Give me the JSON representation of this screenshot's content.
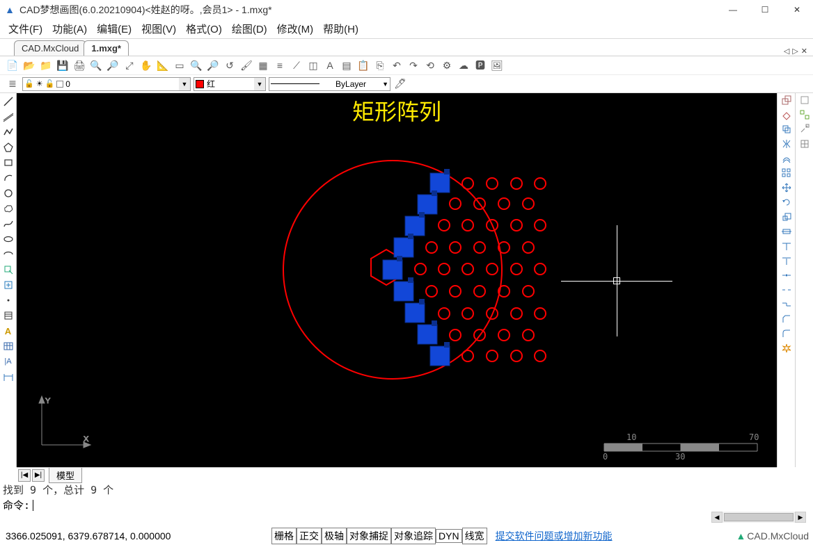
{
  "title": "CAD梦想画图(6.0.20210904)<姓赵的呀。,会员1> - 1.mxg*",
  "menus": [
    "文件(F)",
    "功能(A)",
    "编辑(E)",
    "视图(V)",
    "格式(O)",
    "绘图(D)",
    "修改(M)",
    "帮助(H)"
  ],
  "doc_tabs": {
    "inactive": "CAD.MxCloud",
    "active": "1.mxg*"
  },
  "tabnav_glyphs": [
    "◁",
    "▷",
    "✕"
  ],
  "layer_selector": {
    "value": "0"
  },
  "color_selector": {
    "value": "红"
  },
  "linetype_selector": {
    "value": "ByLayer"
  },
  "viewport_title": "矩形阵列",
  "scale_ticks": {
    "top_left": "10",
    "top_right": "70",
    "bot_left": "0",
    "bot_right": "30"
  },
  "model_tab": "模型",
  "cmd_history": "找到 9 个，总计 9 个",
  "cmd_prompt": "命令:",
  "coords": "3366.025091, 6379.678714, 0.000000",
  "status_toggles": [
    "栅格",
    "正交",
    "极轴",
    "对象捕捉",
    "对象追踪",
    "DYN",
    "线宽"
  ],
  "status_link": "提交软件问题或增加新功能",
  "cloud_label": "CAD.MxCloud",
  "win_glyphs": {
    "min": "—",
    "max": "☐",
    "close": "✕"
  },
  "nav_glyphs": {
    "first": "|◀",
    "next": "▶|"
  }
}
